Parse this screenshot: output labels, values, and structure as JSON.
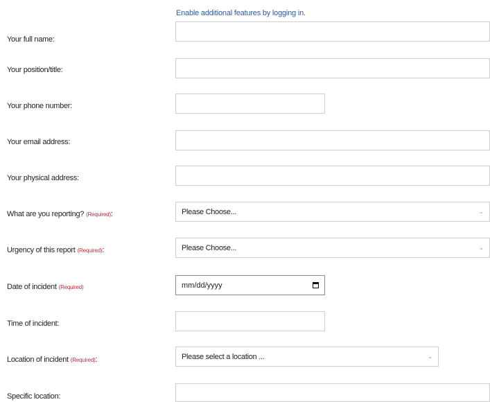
{
  "header": {
    "login_link": "Enable additional features by logging in."
  },
  "fields": {
    "full_name": {
      "label": "Your full name:",
      "value": ""
    },
    "position": {
      "label": "Your position/title:",
      "value": ""
    },
    "phone": {
      "label": "Your phone number:",
      "value": ""
    },
    "email": {
      "label": "Your email address:",
      "value": ""
    },
    "physical_address": {
      "label": "Your physical address:",
      "value": ""
    },
    "reporting": {
      "label": "What are you reporting?",
      "required": "(Required)",
      "suffix": ":",
      "selected": "Please Choose..."
    },
    "urgency": {
      "label": "Urgency of this report",
      "required": "(Required)",
      "suffix": ":",
      "selected": "Please Choose..."
    },
    "date": {
      "label": "Date of incident",
      "required": "(Required)",
      "placeholder": "mm/dd/yyyy"
    },
    "time": {
      "label": "Time of incident:",
      "value": ""
    },
    "location": {
      "label": "Location of incident",
      "required": "(Required)",
      "suffix": ":",
      "selected": "Please select a location ..."
    },
    "specific_location": {
      "label": "Specific location:",
      "value": ""
    }
  },
  "icons": {
    "select_caret": "chevron-down-icon",
    "date_picker": "calendar-icon"
  }
}
